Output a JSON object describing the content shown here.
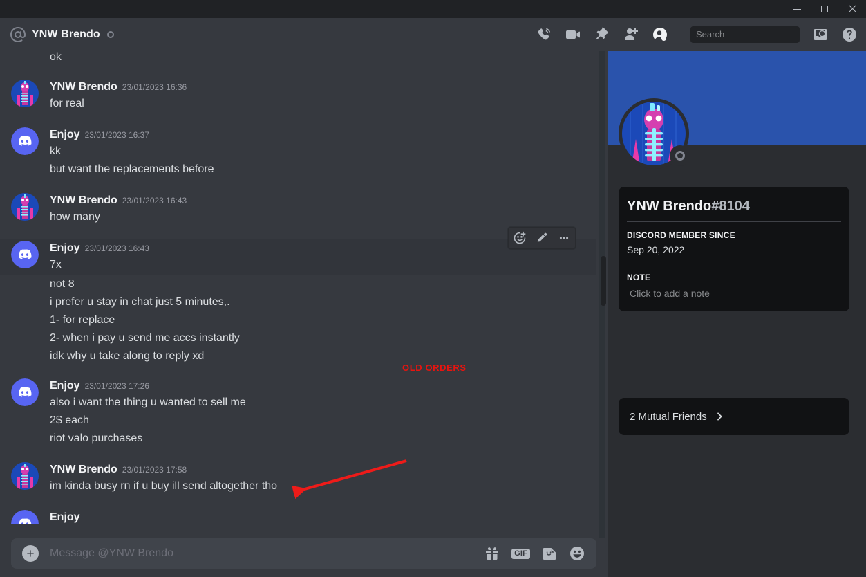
{
  "window": {
    "minimize_label": "Minimize",
    "maximize_label": "Maximize",
    "close_label": "Close"
  },
  "header": {
    "at_icon": "at-icon",
    "title": "YNW Brendo",
    "status": "offline",
    "icons": [
      {
        "name": "start-voice-call-icon",
        "label": "Start Voice Call"
      },
      {
        "name": "start-video-call-icon",
        "label": "Start Video Call"
      },
      {
        "name": "pinned-messages-icon",
        "label": "Pinned Messages"
      },
      {
        "name": "add-friends-to-dm-icon",
        "label": "Add Friends to DM"
      },
      {
        "name": "hide-user-profile-icon",
        "label": "Hide User Profile"
      },
      {
        "name": "inbox-icon",
        "label": "Inbox"
      },
      {
        "name": "help-icon",
        "label": "Help"
      }
    ]
  },
  "search": {
    "placeholder": "Search",
    "value": "",
    "icon": "search-icon"
  },
  "chat": {
    "partial_top_text": "ok",
    "messages": [
      {
        "author": "YNW Brendo",
        "avatar": "ynw-brendo-avatar",
        "timestamp": "23/01/2023 16:36",
        "lines": [
          "for real"
        ]
      },
      {
        "author": "Enjoy",
        "avatar": "enjoy-discord-avatar",
        "timestamp": "23/01/2023 16:37",
        "lines": [
          "kk",
          "but want the replacements before"
        ]
      },
      {
        "author": "YNW Brendo",
        "avatar": "ynw-brendo-avatar",
        "timestamp": "23/01/2023 16:43",
        "lines": [
          "how many"
        ]
      },
      {
        "author": "Enjoy",
        "avatar": "enjoy-discord-avatar",
        "timestamp": "23/01/2023 16:43",
        "lines": [
          "7x",
          "not 8",
          "i prefer u stay in chat just 5 minutes,.",
          "1- for replace",
          "2- when i pay u send me accs instantly",
          "idk why u take along to reply xd"
        ],
        "hovered": true
      },
      {
        "author": "Enjoy",
        "avatar": "enjoy-discord-avatar",
        "timestamp": "23/01/2023 17:26",
        "lines": [
          "also i want the thing u wanted to sell me",
          "2$ each",
          "riot valo purchases"
        ]
      },
      {
        "author": "YNW Brendo",
        "avatar": "ynw-brendo-avatar",
        "timestamp": "23/01/2023 17:58",
        "lines": [
          "im kinda busy rn if u buy ill send altogether tho"
        ]
      }
    ],
    "hover_toolbar": [
      {
        "name": "add-reaction-icon",
        "label": "Add Reaction"
      },
      {
        "name": "edit-message-icon",
        "label": "Edit"
      },
      {
        "name": "more-options-icon",
        "label": "More"
      }
    ]
  },
  "composer": {
    "add_attachment_icon": "plus-icon",
    "placeholder": "Message @YNW Brendo",
    "value": "",
    "icons": [
      {
        "name": "gift-icon",
        "label": "Gift"
      },
      {
        "name": "gif-icon",
        "label": "GIF"
      },
      {
        "name": "sticker-icon",
        "label": "Sticker"
      },
      {
        "name": "emoji-icon",
        "label": "Emoji"
      }
    ]
  },
  "profile": {
    "banner_color": "#2a53ac",
    "avatar": "ynw-brendo-avatar",
    "status": "offline",
    "username": "YNW Brendo",
    "discriminator": "#8104",
    "member_since_label": "DISCORD MEMBER SINCE",
    "member_since_value": "Sep 20, 2022",
    "note_label": "NOTE",
    "note_placeholder": "Click to add a note",
    "mutual_friends": "2 Mutual Friends",
    "mutual_chevron_icon": "chevron-right-icon"
  },
  "annotations": {
    "old_orders_text": "OLD ORDERS",
    "color": "#e8140f",
    "arrow_icon": "red-arrow-icon"
  }
}
